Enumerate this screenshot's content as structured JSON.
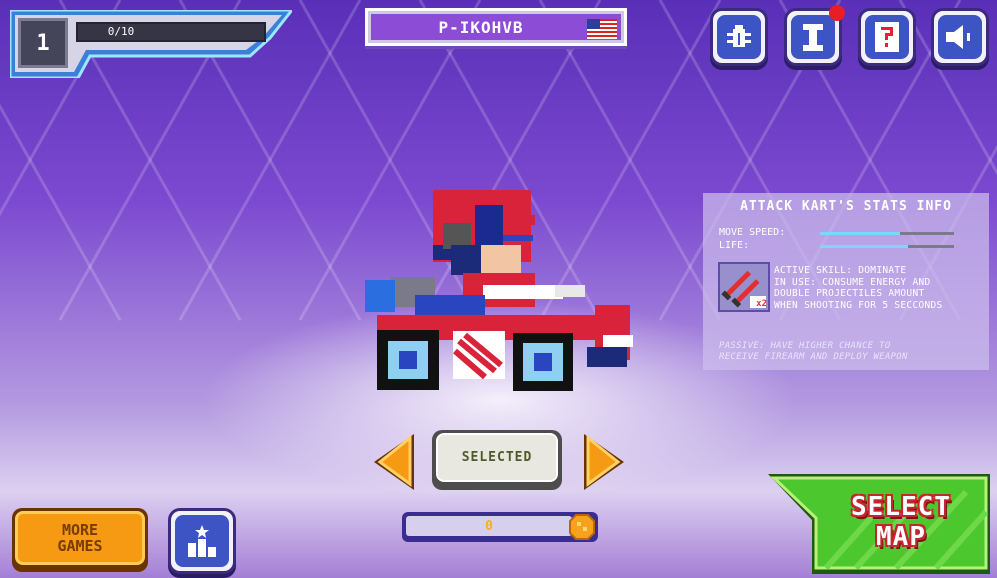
{
  "player": {
    "level": "1",
    "xp_text": "0/10",
    "xp_progress": 0,
    "name": "P-IKOHVB",
    "flag": "us-flag"
  },
  "top_buttons": [
    "bug-report-icon",
    "info-icon",
    "help-icon",
    "sound-icon"
  ],
  "stats": {
    "title": "ATTACK KART'S STATS INFO",
    "move_speed_label": "MOVE SPEED:",
    "move_speed_value": 0.6,
    "life_label": "LIFE:",
    "life_value": 0.66,
    "skill_multiplier": "x2",
    "skill_lines": [
      "ACTIVE SKILL: DOMINATE",
      "IN USE: CONSUME ENERGY AND",
      "DOUBLE PROJECTILES AMOUNT",
      "WHEN SHOOTING FOR 5 SECCONDS"
    ],
    "passive_lines": [
      "PASSIVE: HAVE HIGHER CHANCE TO",
      "RECEIVE FIREARM AND DEPLOY WEAPON"
    ]
  },
  "selector": {
    "selected_label": "SELECTED",
    "coins": "0"
  },
  "more_games_line1": "MORE",
  "more_games_line2": "GAMES",
  "select_map_line1": "SELECT",
  "select_map_line2": "MAP",
  "colors": {
    "accent_blue": "#3d55c4",
    "orange": "#f59a12",
    "green": "#4cc72e",
    "red": "#c2262e"
  }
}
